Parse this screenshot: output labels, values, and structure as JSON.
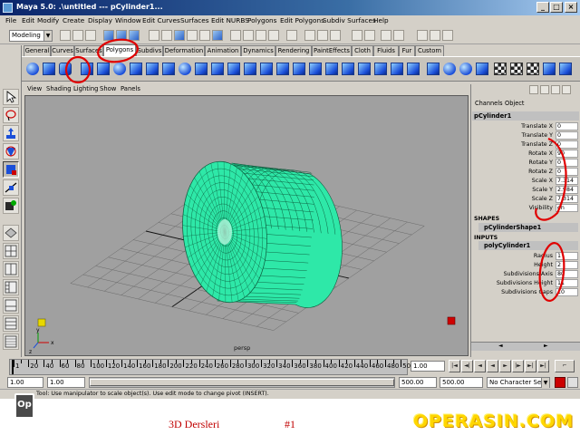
{
  "window": {
    "title": "Maya 5.0: .\\untitled   ---   pCylinder1..."
  },
  "menus": [
    "File",
    "Edit",
    "Modify",
    "Create",
    "Display",
    "Window",
    "Edit Curves",
    "Surfaces",
    "Edit NURBS",
    "Polygons",
    "Edit Polygons",
    "Subdiv Surfaces",
    "Help"
  ],
  "statusline": {
    "mode": "Modeling"
  },
  "shelf": {
    "tabs": [
      "General",
      "Curves",
      "Surfaces",
      "Polygons",
      "Subdivs",
      "Deformation",
      "Animation",
      "Dynamics",
      "Rendering",
      "PaintEffects",
      "Cloth",
      "Fluids",
      "Fur",
      "Custom"
    ],
    "active_tab": "Polygons"
  },
  "viewport": {
    "menus": [
      "View",
      "Shading",
      "Lighting",
      "Show",
      "Panels"
    ],
    "camera_label": "persp",
    "axis_labels": {
      "x": "x",
      "y": "y",
      "z": "z"
    }
  },
  "channel_box": {
    "menus": [
      "Channels",
      "Object"
    ],
    "object_name": "pCylinder1",
    "attributes": [
      {
        "label": "Translate X",
        "value": "0"
      },
      {
        "label": "Translate Y",
        "value": "0"
      },
      {
        "label": "Translate Z",
        "value": "0"
      },
      {
        "label": "Rotate X",
        "value": "90"
      },
      {
        "label": "Rotate Y",
        "value": "0"
      },
      {
        "label": "Rotate Z",
        "value": "0"
      },
      {
        "label": "Scale X",
        "value": "7.314"
      },
      {
        "label": "Scale Y",
        "value": "2.984"
      },
      {
        "label": "Scale Z",
        "value": "7.314"
      },
      {
        "label": "Visibility",
        "value": "on"
      }
    ],
    "shapes_header": "SHAPES",
    "shape_name": "pCylinderShape1",
    "inputs_header": "INPUTS",
    "input_name": "polyCylinder1",
    "input_attributes": [
      {
        "label": "Radius",
        "value": "1"
      },
      {
        "label": "Height",
        "value": "2"
      },
      {
        "label": "Subdivisions Axis",
        "value": "80"
      },
      {
        "label": "Subdivisions Height",
        "value": "11"
      },
      {
        "label": "Subdivisions Caps",
        "value": "10"
      }
    ]
  },
  "timeline": {
    "tick_labels": [
      "1",
      "20",
      "40",
      "60",
      "80",
      "100",
      "120",
      "140",
      "160",
      "180",
      "200",
      "220",
      "240",
      "260",
      "280",
      "300",
      "320",
      "340",
      "360",
      "380",
      "400",
      "420",
      "440",
      "460",
      "480",
      "500"
    ],
    "current_time": "1.00"
  },
  "range": {
    "start_time": "1.00",
    "anim_start": "1.00",
    "end_time": "500.00",
    "anim_end": "500.00",
    "character_set": "No Character Set"
  },
  "help_line": "Tool: Use manipulator to scale object(s). Use edit mode to change pivot (INSERT).",
  "overlay": {
    "badge": "Op",
    "title": "3D Dersleri",
    "number": "#1",
    "watermark": "OPERASIN.COM"
  },
  "colors": {
    "mesh": "#2ee8a8",
    "wire": "#0c5a3c",
    "viewport_bg": "#a0a0a0",
    "annotation": "#e00000"
  }
}
